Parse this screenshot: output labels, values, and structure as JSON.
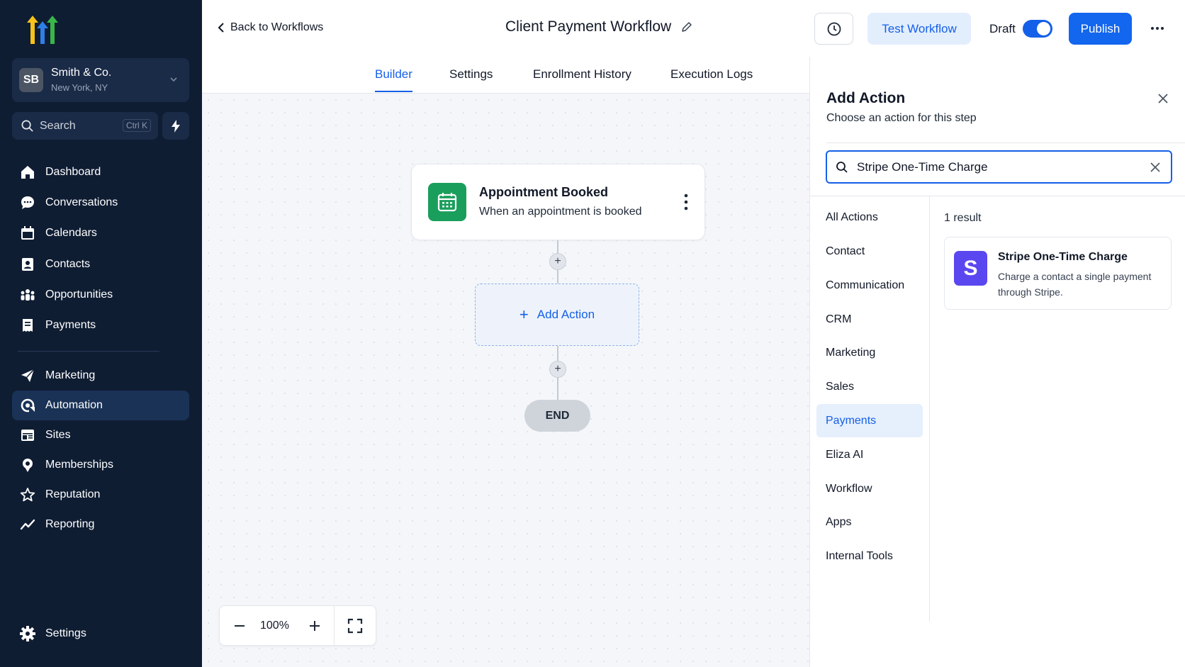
{
  "sidebar": {
    "account": {
      "initials": "SB",
      "name": "Smith & Co.",
      "location": "New York, NY"
    },
    "search": {
      "label": "Search",
      "shortcut": "Ctrl K"
    },
    "items": [
      {
        "label": "Dashboard",
        "icon": "home-icon"
      },
      {
        "label": "Conversations",
        "icon": "chat-bubble-icon"
      },
      {
        "label": "Calendars",
        "icon": "calendar-icon"
      },
      {
        "label": "Contacts",
        "icon": "contact-card-icon"
      },
      {
        "label": "Opportunities",
        "icon": "people-group-icon"
      },
      {
        "label": "Payments",
        "icon": "receipt-icon"
      },
      {
        "label": "Marketing",
        "icon": "send-icon"
      },
      {
        "label": "Automation",
        "icon": "automation-icon",
        "active": true
      },
      {
        "label": "Sites",
        "icon": "sites-icon"
      },
      {
        "label": "Memberships",
        "icon": "badge-icon"
      },
      {
        "label": "Reputation",
        "icon": "star-icon"
      },
      {
        "label": "Reporting",
        "icon": "trend-icon"
      }
    ],
    "settings_label": "Settings"
  },
  "header": {
    "back_label": "Back to Workflows",
    "title": "Client Payment Workflow",
    "test_label": "Test Workflow",
    "draft_label": "Draft",
    "draft_on": true,
    "publish_label": "Publish"
  },
  "tabs": [
    {
      "label": "Builder",
      "active": true
    },
    {
      "label": "Settings"
    },
    {
      "label": "Enrollment History"
    },
    {
      "label": "Execution Logs"
    }
  ],
  "canvas": {
    "trigger": {
      "title": "Appointment Booked",
      "subtitle": "When an appointment is booked"
    },
    "add_action_label": "Add Action",
    "end_label": "END",
    "zoom": "100%"
  },
  "panel": {
    "title": "Add Action",
    "subtitle": "Choose an action for this step",
    "search_value": "Stripe One-Time Charge",
    "categories": [
      "All Actions",
      "Contact",
      "Communication",
      "CRM",
      "Marketing",
      "Sales",
      "Payments",
      "Eliza AI",
      "Workflow",
      "Apps",
      "Internal Tools"
    ],
    "active_category": "Payments",
    "result_count": "1 result",
    "result": {
      "logo_letter": "S",
      "title": "Stripe One-Time Charge",
      "description": "Charge a contact a single payment through Stripe."
    }
  },
  "colors": {
    "sidebar_bg": "#0f1d33",
    "accent": "#1560e8",
    "trigger_icon_bg": "#1a9e5c",
    "stripe": "#5b47f0"
  }
}
